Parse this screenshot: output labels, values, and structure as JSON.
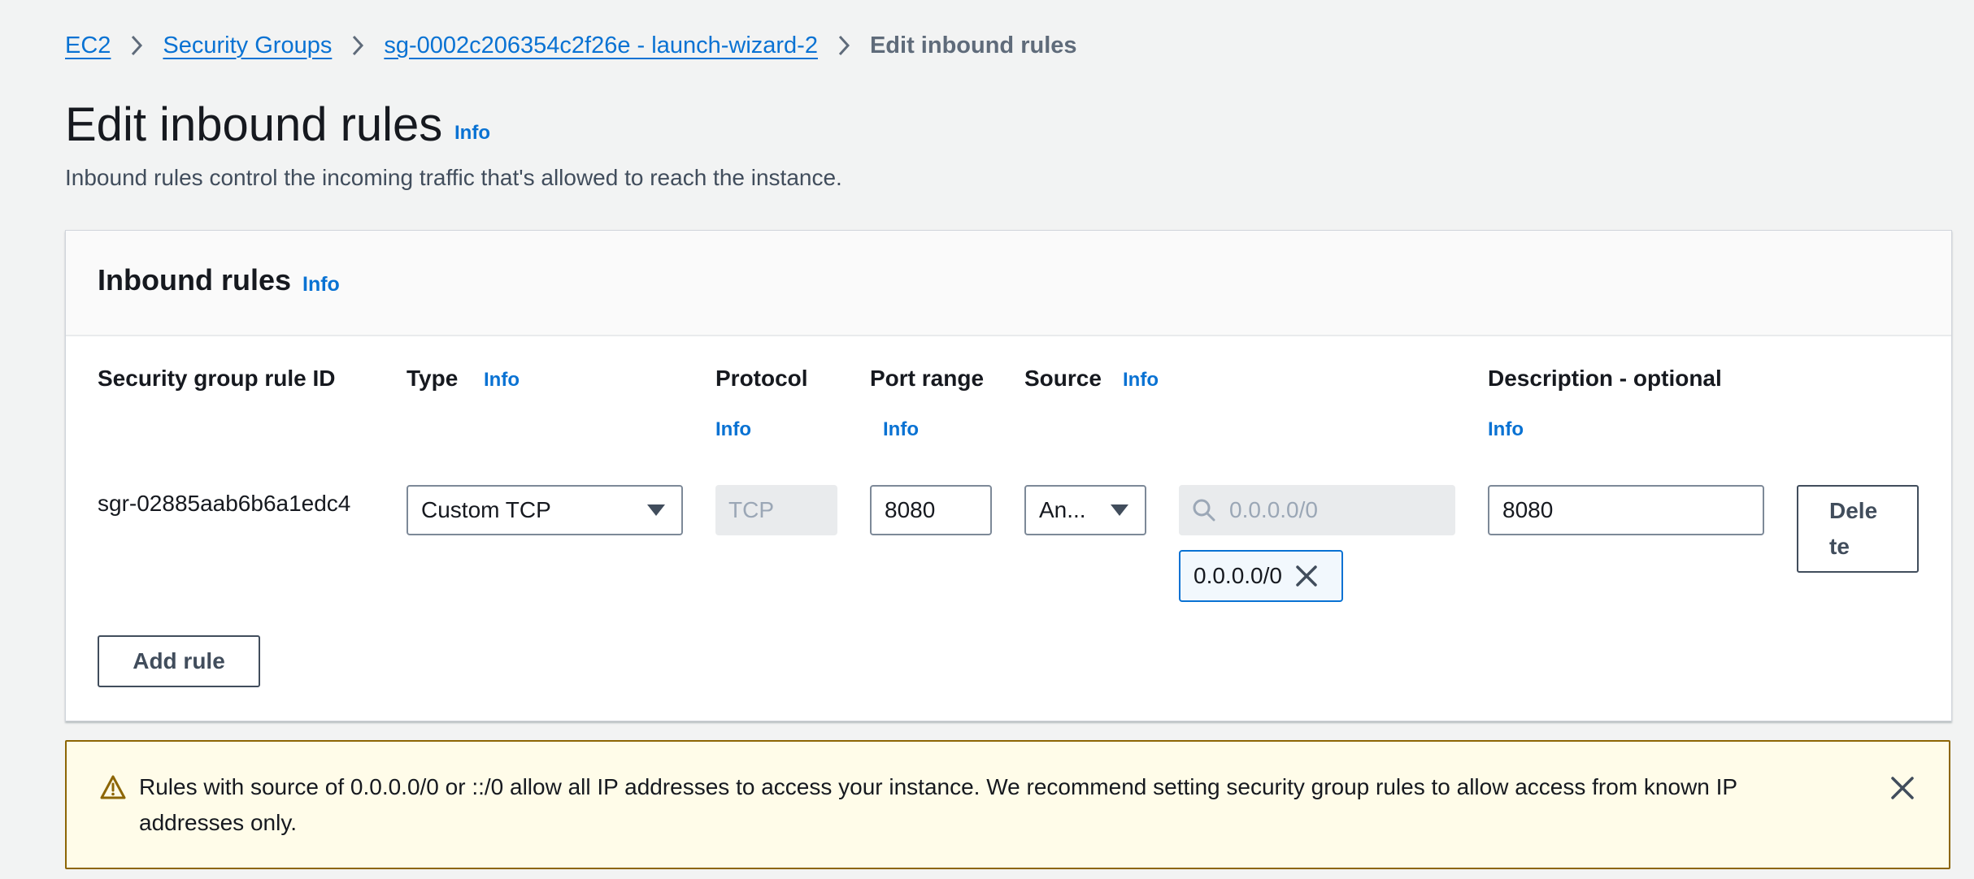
{
  "breadcrumb": {
    "items": [
      "EC2",
      "Security Groups",
      "sg-0002c206354c2f26e - launch-wizard-2"
    ],
    "current": "Edit inbound rules"
  },
  "page": {
    "title": "Edit inbound rules",
    "info": "Info",
    "description": "Inbound rules control the incoming traffic that's allowed to reach the instance."
  },
  "panel": {
    "title": "Inbound rules",
    "info": "Info",
    "columns": {
      "rule_id": "Security group rule ID",
      "type": "Type",
      "type_info": "Info",
      "protocol": "Protocol",
      "protocol_info": "Info",
      "port_range": "Port range",
      "port_range_info": "Info",
      "source": "Source",
      "source_info": "Info",
      "description": "Description - optional",
      "description_info": "Info"
    },
    "rule": {
      "id": "sgr-02885aab6b6a1edc4",
      "type": "Custom TCP",
      "protocol": "TCP",
      "port_range": "8080",
      "source_type": "An...",
      "source_search_placeholder": "0.0.0.0/0",
      "source_token": "0.0.0.0/0",
      "description": "8080",
      "delete_label_1": "Dele",
      "delete_label_2": "te"
    },
    "add_rule_label": "Add rule"
  },
  "alert": {
    "message": "Rules with source of 0.0.0.0/0 or ::/0 allow all IP addresses to access your instance. We recommend setting security group rules to allow access from known IP addresses only."
  },
  "colors": {
    "link": "#0972d3",
    "warning_bg": "#fffce9",
    "warning_border": "#8d6605"
  }
}
